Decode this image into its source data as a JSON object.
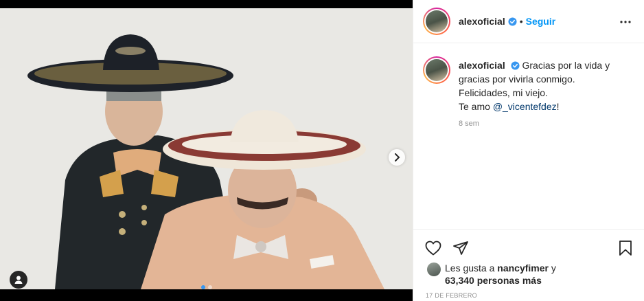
{
  "post": {
    "username": "alexoficial",
    "follow_label": "Seguir",
    "separator": "•",
    "caption_line1": "Gracias por la vida y",
    "caption_line2": "gracias por vivirla conmigo.",
    "caption_line3": "Felicidades, mi viejo.",
    "caption_line4_prefix": "Te amo ",
    "caption_mention": "@_vicentefdez",
    "caption_line4_suffix": "!",
    "time_ago": "8 sem",
    "likes_prefix": "Les gusta a ",
    "likes_user": "nancyfimer",
    "likes_mid": " y",
    "likes_count": "63,340 personas más",
    "date": "17 DE FEBRERO"
  },
  "carousel": {
    "slide_count": 2,
    "active_index": 0
  },
  "icons": {
    "verified": "verified-badge-icon",
    "more": "more-options-icon",
    "next": "chevron-right-icon",
    "user_tag": "user-tag-icon",
    "like": "heart-icon",
    "share": "send-icon",
    "save": "bookmark-icon"
  },
  "colors": {
    "accent": "#0095f6",
    "verified": "#3897f0",
    "mention": "#00376b",
    "muted": "#8e8e8e",
    "text": "#262626",
    "border": "#efefef"
  }
}
